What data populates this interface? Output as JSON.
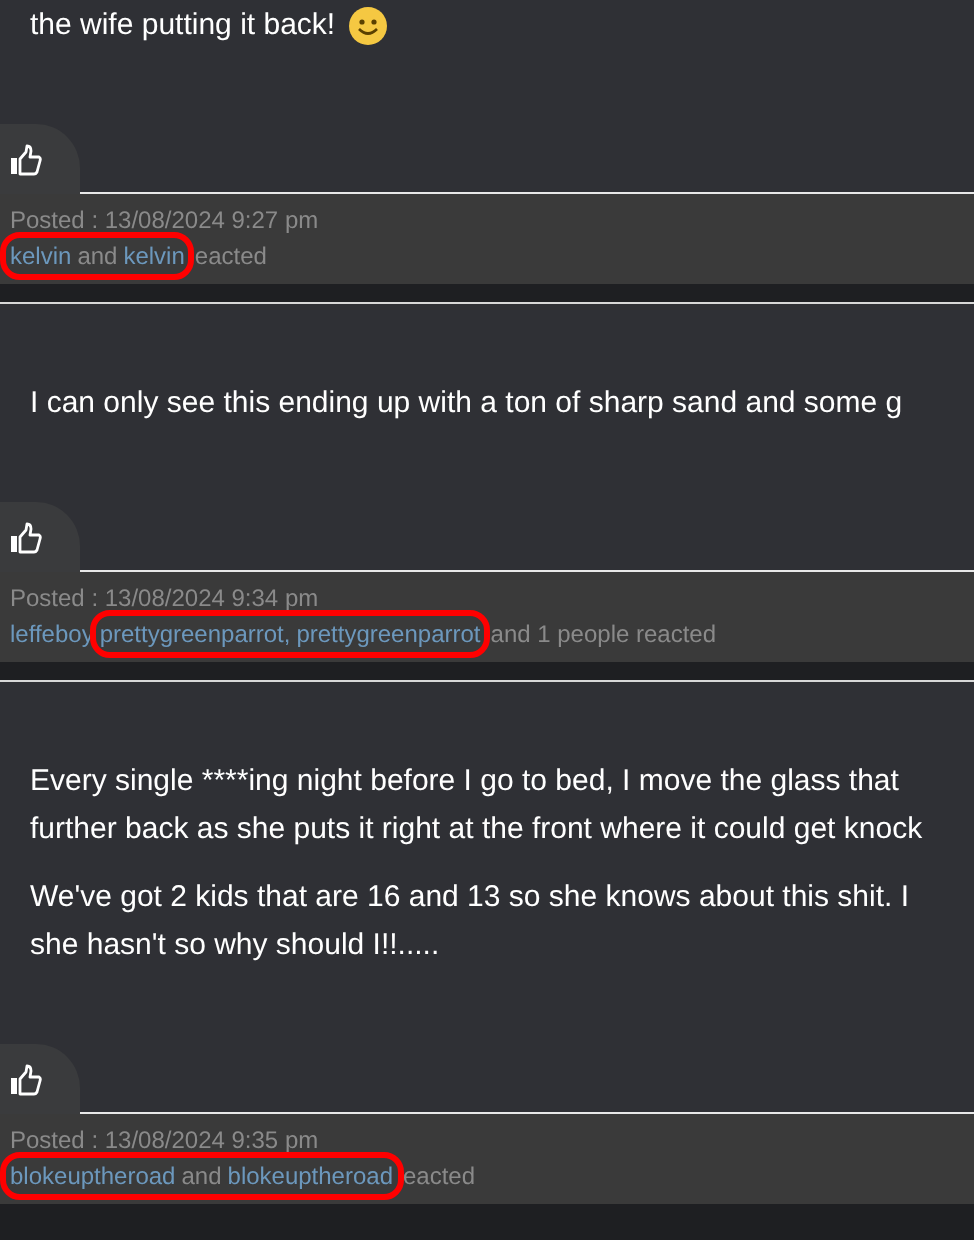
{
  "posts": [
    {
      "paragraphs": [
        {
          "lines": [
            "the wife putting it back!"
          ],
          "emoji": true
        }
      ],
      "posted": "Posted : 13/08/2024 9:27 pm",
      "reactions": [
        {
          "text": "kelvin",
          "kind": "link",
          "circled": true
        },
        {
          "text": "and",
          "kind": "plain",
          "circled": true
        },
        {
          "text": "kelvin",
          "kind": "link",
          "circled": true
        },
        {
          "text": "eacted",
          "kind": "plain",
          "circled": false
        }
      ]
    },
    {
      "paragraphs": [
        {
          "lines": [
            "I can only see this ending up with a ton of sharp sand and some g"
          ],
          "emoji": false
        }
      ],
      "posted": "Posted : 13/08/2024 9:34 pm",
      "reactions": [
        {
          "text": "leffeboy",
          "kind": "link",
          "circled": false
        },
        {
          "text": "prettygreenparrot,",
          "kind": "link",
          "circled": true
        },
        {
          "text": "prettygreenparrot",
          "kind": "link",
          "circled": true
        },
        {
          "text": "and 1 people reacted",
          "kind": "plain",
          "circled": false
        }
      ]
    },
    {
      "paragraphs": [
        {
          "lines": [
            "Every single ****ing night before I go to bed, I move the glass that",
            "further back as she puts it right at the front where it could get knock"
          ],
          "emoji": false
        },
        {
          "lines": [
            "We've got 2 kids that are 16 and 13 so she knows about this shit. I",
            "she hasn't so why should I!!....."
          ],
          "emoji": false
        }
      ],
      "posted": "Posted : 13/08/2024 9:35 pm",
      "reactions": [
        {
          "text": "blokeuptheroad",
          "kind": "link",
          "circled": true
        },
        {
          "text": "and",
          "kind": "plain",
          "circled": true
        },
        {
          "text": "blokeuptheroad",
          "kind": "link",
          "circled": true
        },
        {
          "text": "eacted",
          "kind": "plain",
          "circled": false
        }
      ]
    }
  ]
}
